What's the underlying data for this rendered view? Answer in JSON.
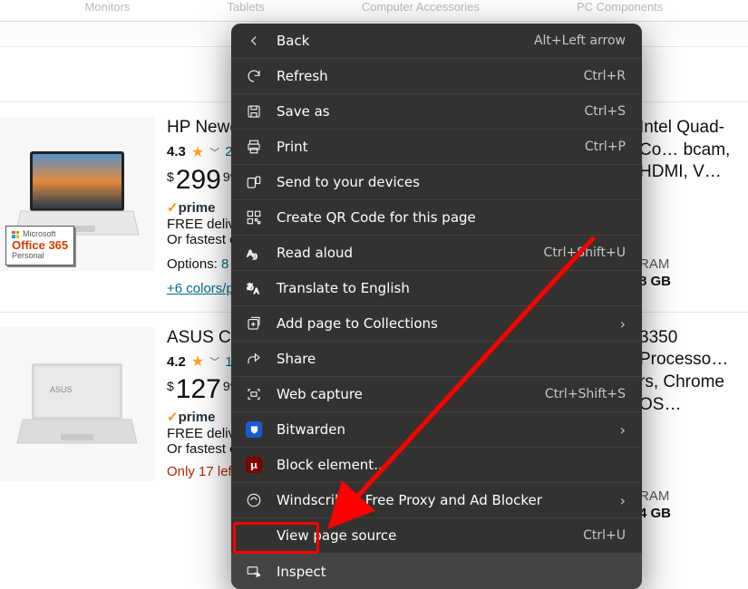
{
  "nav": [
    "Monitors",
    "Tablets",
    "Computer Accessories",
    "PC Components"
  ],
  "products": [
    {
      "title": "HP Newe… Storage(…",
      "rating": "4.3",
      "rating_count": "21…",
      "currency": "$",
      "price_whole": "299",
      "price_frac": "99",
      "prime": "✓prime",
      "line1": "FREE delive…",
      "line2": "Or fastest o…",
      "options_prefix": "Options: ",
      "options_link": "8 ca…",
      "colors": "+6 colors/pa…",
      "spec_label": "RAM",
      "spec_value": "8 GB",
      "title_right": "Intel Quad-Co… bcam, HDMI, V…"
    },
    {
      "title": "ASUS C5… Flash Me…",
      "rating": "4.2",
      "rating_count": "1,3…",
      "currency": "$",
      "price_whole": "127",
      "price_frac": "99",
      "prime": "✓prime",
      "line1": "FREE delive…",
      "line2": "Or fastest o…",
      "stock": "Only 17 left in stock - order soon",
      "spec_label": "RAM",
      "spec_value": "4 GB",
      "title_right": "3350 Processo… rs, Chrome OS…"
    }
  ],
  "office_badge": {
    "ms": "Microsoft",
    "o365": "Office 365",
    "pers": "Personal"
  },
  "context_menu": [
    {
      "id": "back",
      "label": "Back",
      "accel": "Alt+Left arrow",
      "icon": "back"
    },
    {
      "id": "refresh",
      "label": "Refresh",
      "accel": "Ctrl+R",
      "icon": "refresh"
    },
    {
      "id": "saveas",
      "label": "Save as",
      "accel": "Ctrl+S",
      "icon": "save"
    },
    {
      "id": "print",
      "label": "Print",
      "accel": "Ctrl+P",
      "icon": "print"
    },
    {
      "id": "send",
      "label": "Send to your devices",
      "icon": "send"
    },
    {
      "id": "qr",
      "label": "Create QR Code for this page",
      "icon": "qr"
    },
    {
      "id": "read",
      "label": "Read aloud",
      "accel": "Ctrl+Shift+U",
      "icon": "read"
    },
    {
      "id": "translate",
      "label": "Translate to English",
      "icon": "translate"
    },
    {
      "id": "collections",
      "label": "Add page to Collections",
      "chev": true,
      "icon": "collections"
    },
    {
      "id": "share",
      "label": "Share",
      "icon": "share"
    },
    {
      "id": "capture",
      "label": "Web capture",
      "accel": "Ctrl+Shift+S",
      "icon": "capture"
    },
    {
      "id": "bitwarden",
      "label": "Bitwarden",
      "chev": true,
      "icon": "bitwarden"
    },
    {
      "id": "block",
      "label": "Block element...",
      "icon": "ublock"
    },
    {
      "id": "windscribe",
      "label": "Windscribe - Free Proxy and Ad Blocker",
      "chev": true,
      "icon": "windscribe"
    },
    {
      "id": "source",
      "label": "View page source",
      "accel": "Ctrl+U",
      "icon": "blank"
    },
    {
      "id": "inspect",
      "label": "Inspect",
      "icon": "inspect",
      "highlight": true
    }
  ]
}
